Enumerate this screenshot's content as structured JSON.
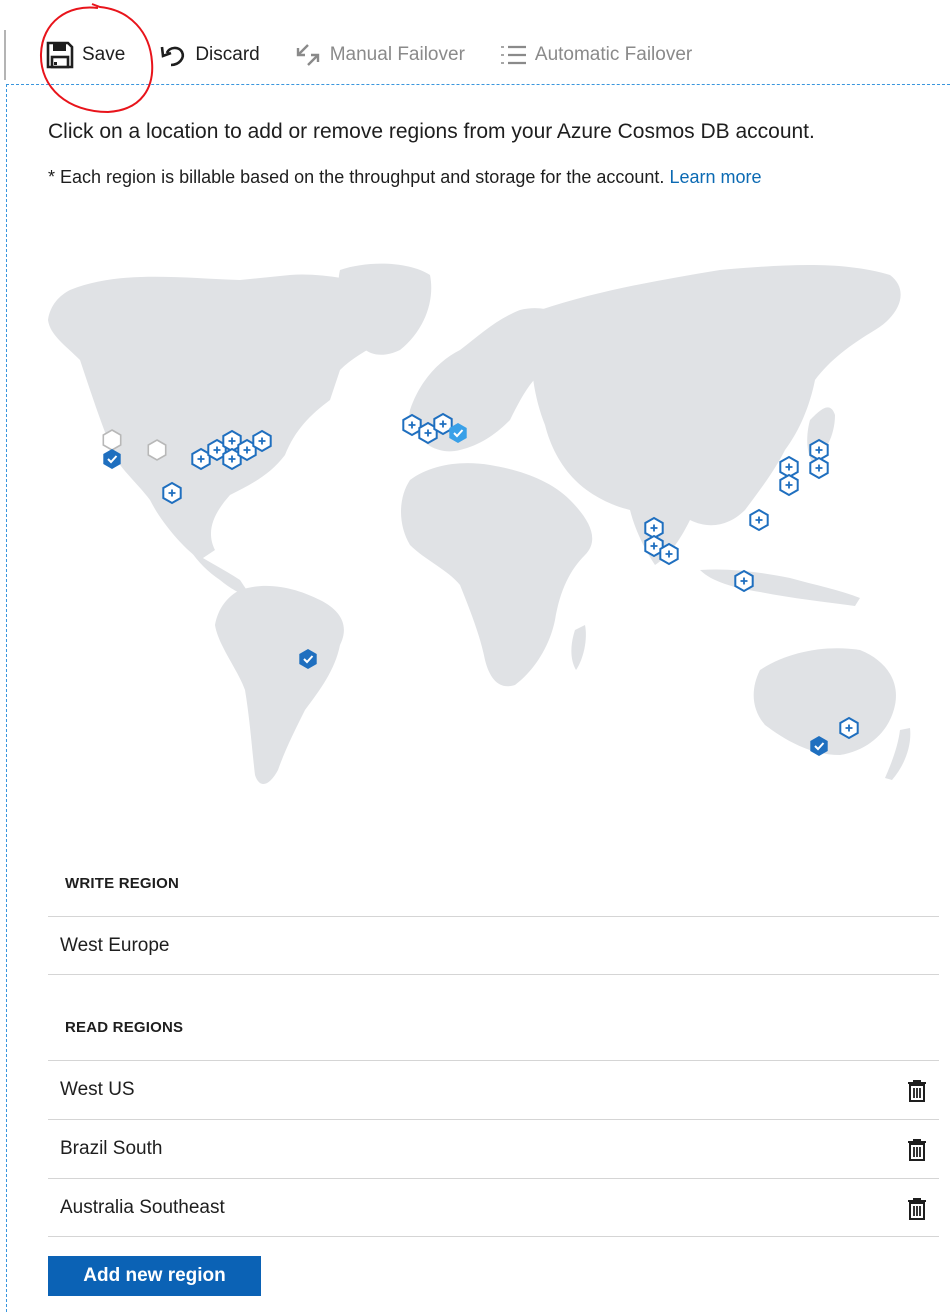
{
  "toolbar": {
    "save_label": "Save",
    "discard_label": "Discard",
    "manual_failover_label": "Manual Failover",
    "automatic_failover_label": "Automatic Failover"
  },
  "intro_text": "Click on a location to add or remove regions from your Azure Cosmos DB account.",
  "billing_note": "* Each region is billable based on the throughput and storage for the account.",
  "learn_more_label": "Learn more",
  "write_region": {
    "heading": "WRITE REGION",
    "name": "West Europe"
  },
  "read_regions": {
    "heading": "READ REGIONS",
    "items": [
      {
        "name": "West US"
      },
      {
        "name": "Brazil South"
      },
      {
        "name": "Australia Southeast"
      }
    ]
  },
  "add_region_label": "Add new region",
  "colors": {
    "accent": "#0b62b5",
    "link": "#0b6ab3",
    "selected_marker": "#1f6fbf",
    "write_marker": "#39a0e8",
    "map_land": "#e0e2e5",
    "annotation": "#e8141b"
  },
  "icons": {
    "save": "save-icon",
    "discard": "undo-icon",
    "manual_failover": "swap-arrows-icon",
    "automatic_failover": "numbered-list-icon",
    "delete": "trash-icon"
  }
}
